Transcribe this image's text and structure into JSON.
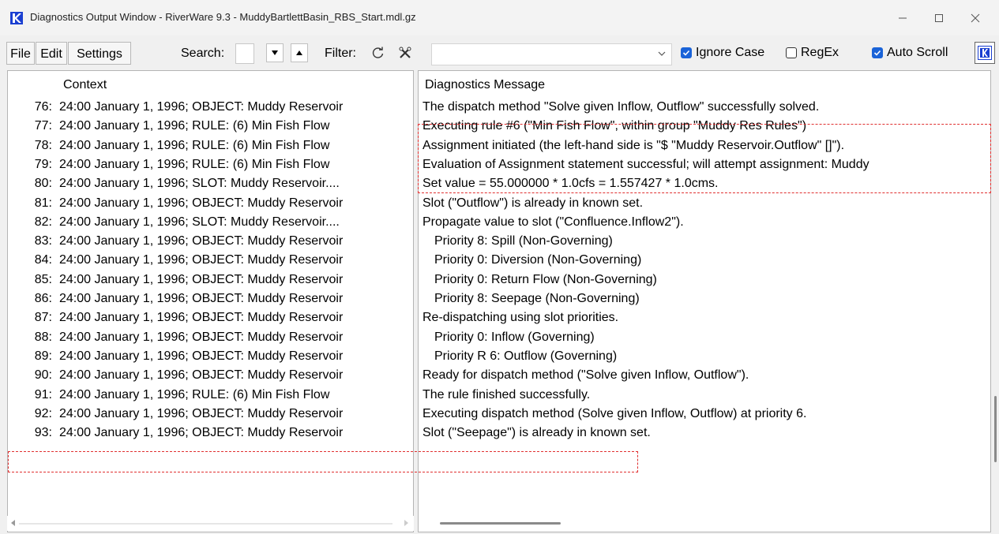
{
  "window": {
    "title": "Diagnostics Output Window - RiverWare 9.3 - MuddyBartlettBasin_RBS_Start.mdl.gz"
  },
  "toolbar": {
    "file_label": "File",
    "edit_label": "Edit",
    "settings_label": "Settings",
    "search_label": "Search:",
    "search_value": "",
    "filter_label": "Filter:",
    "filter_value": "",
    "ignore_case_label": "Ignore Case",
    "ignore_case_checked": true,
    "regex_label": "RegEx",
    "regex_checked": false,
    "auto_scroll_label": "Auto Scroll",
    "auto_scroll_checked": true
  },
  "table": {
    "context_header": "Context",
    "message_header": "Diagnostics Message",
    "rows": [
      {
        "num": "76:",
        "context": "24:00 January 1, 1996; OBJECT: Muddy Reservoir",
        "message": "The dispatch method \"Solve given Inflow, Outflow\" successfully solved."
      },
      {
        "num": "77:",
        "context": "24:00 January 1, 1996; RULE: (6) Min Fish Flow",
        "message": "Executing rule #6 (\"Min Fish Flow\", within group \"Muddy Res Rules\")"
      },
      {
        "num": "78:",
        "context": "24:00 January 1, 1996; RULE: (6) Min Fish Flow",
        "message": "Assignment initiated (the left-hand side  is \"$ \"Muddy Reservoir.Outflow\" []\")."
      },
      {
        "num": "79:",
        "context": "24:00 January 1, 1996; RULE: (6) Min Fish Flow",
        "message": "Evaluation of Assignment statement successful; will attempt assignment: Muddy"
      },
      {
        "num": "80:",
        "context": "24:00 January 1, 1996; SLOT: Muddy Reservoir....",
        "message": "Set value = 55.000000 * 1.0cfs = 1.557427 * 1.0cms."
      },
      {
        "num": "81:",
        "context": "24:00 January 1, 1996; OBJECT: Muddy Reservoir",
        "message": "Slot (\"Outflow\") is already in known set."
      },
      {
        "num": "82:",
        "context": "24:00 January 1, 1996; SLOT: Muddy Reservoir....",
        "message": "Propagate value to slot (\"Confluence.Inflow2\")."
      },
      {
        "num": "83:",
        "context": "24:00 January 1, 1996; OBJECT: Muddy Reservoir",
        "message": "Priority  8: Spill (Non-Governing)",
        "indent": true
      },
      {
        "num": "84:",
        "context": "24:00 January 1, 1996; OBJECT: Muddy Reservoir",
        "message": "Priority  0: Diversion (Non-Governing)",
        "indent": true
      },
      {
        "num": "85:",
        "context": "24:00 January 1, 1996; OBJECT: Muddy Reservoir",
        "message": "Priority  0: Return Flow (Non-Governing)",
        "indent": true
      },
      {
        "num": "86:",
        "context": "24:00 January 1, 1996; OBJECT: Muddy Reservoir",
        "message": "Priority  8: Seepage (Non-Governing)",
        "indent": true
      },
      {
        "num": "87:",
        "context": "24:00 January 1, 1996; OBJECT: Muddy Reservoir",
        "message": "Re-dispatching using slot priorities."
      },
      {
        "num": "88:",
        "context": "24:00 January 1, 1996; OBJECT: Muddy Reservoir",
        "message": "Priority  0: Inflow (Governing)",
        "indent": true
      },
      {
        "num": "89:",
        "context": "24:00 January 1, 1996; OBJECT: Muddy Reservoir",
        "message": "Priority R 6: Outflow (Governing)",
        "indent": true
      },
      {
        "num": "90:",
        "context": "24:00 January 1, 1996; OBJECT: Muddy Reservoir",
        "message": "Ready for dispatch method (\"Solve given Inflow, Outflow\")."
      },
      {
        "num": "91:",
        "context": "24:00 January 1, 1996; RULE: (6) Min Fish Flow",
        "message": "The rule finished successfully."
      },
      {
        "num": "92:",
        "context": "24:00 January 1, 1996; OBJECT: Muddy Reservoir",
        "message": "Executing dispatch method (Solve given Inflow, Outflow) at priority 6."
      },
      {
        "num": "93:",
        "context": "24:00 January 1, 1996; OBJECT: Muddy Reservoir",
        "message": "Slot (\"Seepage\") is already in known set."
      }
    ]
  },
  "colors": {
    "highlight": "#e03030",
    "checkbox_accent": "#1a63d8",
    "app_icon": "#1a3fd1"
  },
  "icons": {
    "app": "riverware-logo-icon",
    "minimize": "minimize-icon",
    "maximize": "maximize-icon",
    "close": "close-icon",
    "search_down": "arrow-down-icon",
    "search_up": "arrow-up-icon",
    "filter_refresh": "refresh-icon",
    "filter_clear": "clear-filter-icon",
    "dropdown": "chevron-down-icon",
    "pin": "riverware-pin-icon"
  }
}
